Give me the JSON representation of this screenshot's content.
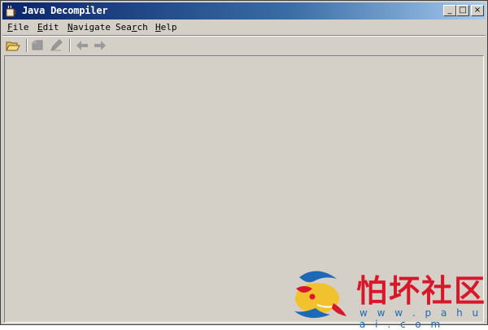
{
  "window": {
    "title": "Java Decompiler"
  },
  "titlebar_buttons": {
    "minimize": "_",
    "maximize": "□",
    "close": "×"
  },
  "menu": [
    {
      "label": "File",
      "mnemonic": "F",
      "rest": "ile"
    },
    {
      "label": "Edit",
      "mnemonic": "E",
      "rest": "dit"
    },
    {
      "label": "Navigate",
      "mnemonic": "N",
      "rest": "avigate"
    },
    {
      "label": "Search",
      "mnemonic": "S",
      "pre": "Sea",
      "mnemonic2": "r",
      "rest2": "ch"
    },
    {
      "label": "Help",
      "mnemonic": "H",
      "rest": "elp"
    }
  ],
  "toolbar": {
    "icons": [
      "open-folder-icon",
      "save-icon",
      "edit-icon",
      "back-arrow-icon",
      "forward-arrow-icon"
    ]
  },
  "watermark": {
    "text": "怕坏社区",
    "url": "w w w . p a h u a i . c o m"
  },
  "colors": {
    "titlebar_start": "#0a246a",
    "window_bg": "#d4d0c8",
    "watermark_red": "#d9172a",
    "watermark_blue": "#1c6ab5"
  }
}
